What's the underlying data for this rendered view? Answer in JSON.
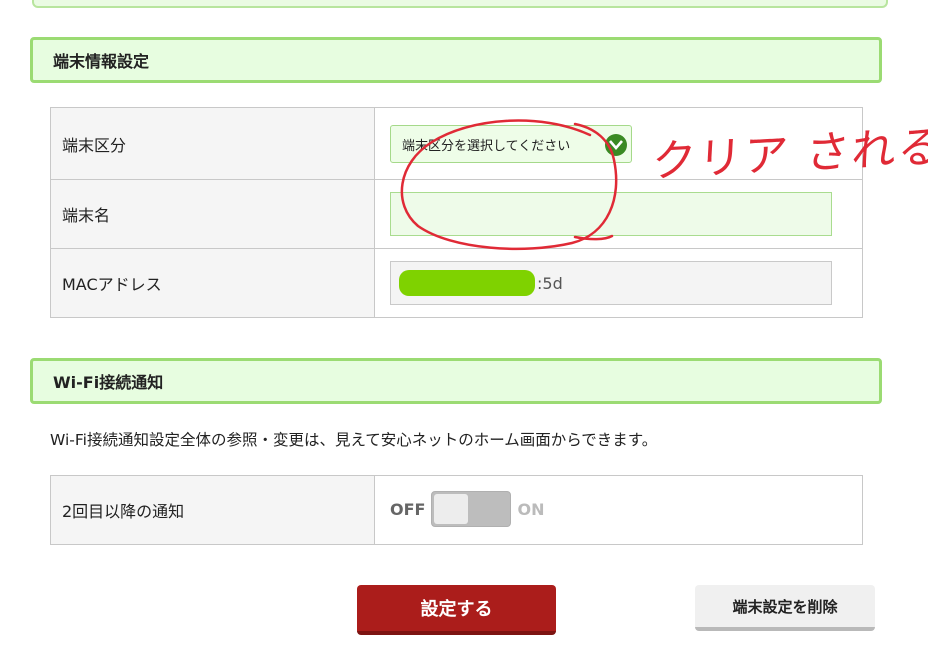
{
  "device_section": {
    "title": "端末情報設定",
    "rows": {
      "type_label": "端末区分",
      "type_select_value": "端末区分を選択してください",
      "name_label": "端末名",
      "name_value": "",
      "mac_label": "MACアドレス",
      "mac_visible_suffix": ":5d"
    }
  },
  "wifi_section": {
    "title": "Wi-Fi接続通知",
    "notice": "Wi-Fi接続通知設定全体の参照・変更は、見えて安心ネットのホーム画面からできます。",
    "row_label": "2回目以降の通知",
    "toggle_off_label": "OFF",
    "toggle_on_label": "ON",
    "toggle_state": "off"
  },
  "buttons": {
    "submit_label": "設定する",
    "delete_label": "端末設定を削除"
  },
  "annotation": {
    "text": "クリア される",
    "color": "#e02a36"
  },
  "colors": {
    "header_bg": "#e7fde0",
    "header_border": "#9bdb73",
    "submit_bg": "#ab1d1b",
    "chevron": "#3a8a23"
  }
}
